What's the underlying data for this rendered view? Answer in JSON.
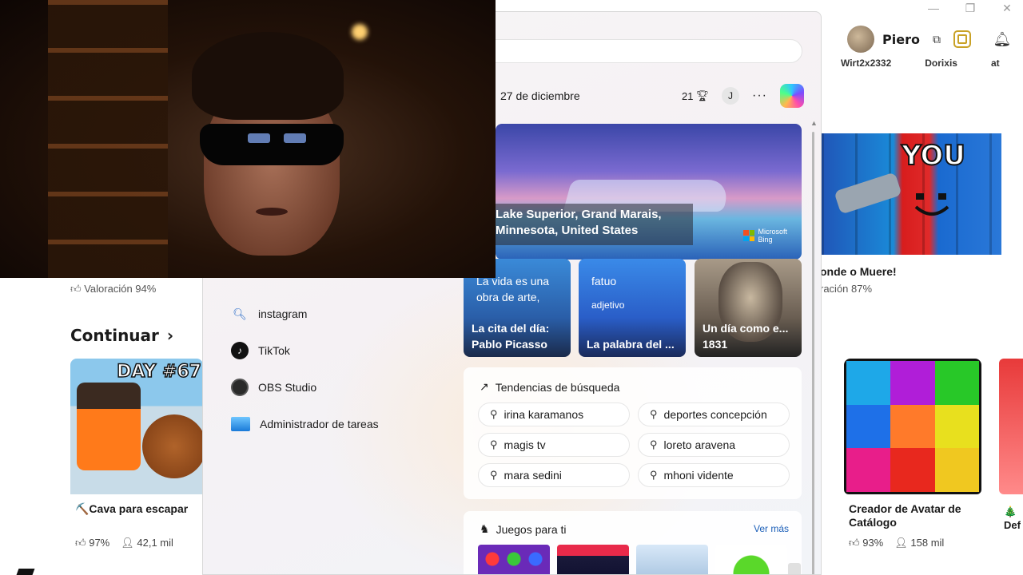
{
  "roblox": {
    "user": {
      "name": "Piero"
    },
    "cut_friend_names": [
      "Wirt2x2332",
      "Dorixis",
      "at"
    ],
    "game_you": {
      "overlay_text": "YOU",
      "title_partial": "onde o Muere!",
      "rating_partial": "ración 87%"
    },
    "left_rating": "Valoración 94%",
    "continuar": {
      "heading": "Continuar"
    },
    "card_day": {
      "overlay_text": "DAY #67",
      "title": "⛏️Cava para escapar",
      "rating": "97%",
      "players": "42,1 mil"
    },
    "card_avatar": {
      "title": "Creador de Avatar de Catálogo",
      "rating": "93%",
      "players": "158 mil"
    },
    "card_partial": {
      "title": "🎄\nDef"
    },
    "icons": {
      "thumbs_up": "thumbs-up-icon",
      "person": "person-icon"
    }
  },
  "startmenu": {
    "list": [
      {
        "icon": "search-icon",
        "label": "instagram"
      },
      {
        "icon": "tiktok-icon",
        "label": "TikTok"
      },
      {
        "icon": "obs-icon",
        "label": "OBS Studio"
      },
      {
        "icon": "task-manager-icon",
        "label": "Administrador de tareas"
      }
    ],
    "widgets": {
      "date": "27 de diciembre",
      "trophy_count": "21",
      "account_initial": "J",
      "more": "···",
      "bing": {
        "caption_line1": "Lake Superior, Grand Marais,",
        "caption_line2": "Minnesota, United States",
        "logo_line1": "Microsoft",
        "logo_line2": "Bing"
      },
      "tiles": [
        {
          "top": "La vida es una obra de arte,",
          "bottom_line1": "La cita del día:",
          "bottom_line2": "Pablo Picasso"
        },
        {
          "top": "fatuo",
          "sub": "adjetivo",
          "bottom_line1": "La palabra del ..."
        },
        {
          "bottom_line1": "Un día como e...",
          "bottom_line2": "1831"
        }
      ],
      "trends": {
        "heading": "Tendencias de búsqueda",
        "items": [
          "irina karamanos",
          "deportes concepción",
          "magis tv",
          "loreto aravena",
          "mara sedini",
          "mhoni vidente"
        ]
      },
      "games": {
        "heading": "Juegos para ti",
        "more": "Ver más"
      }
    }
  },
  "colors": {
    "accent_link": "#1a5eb8",
    "menu_bg": "#f5f2f4"
  }
}
